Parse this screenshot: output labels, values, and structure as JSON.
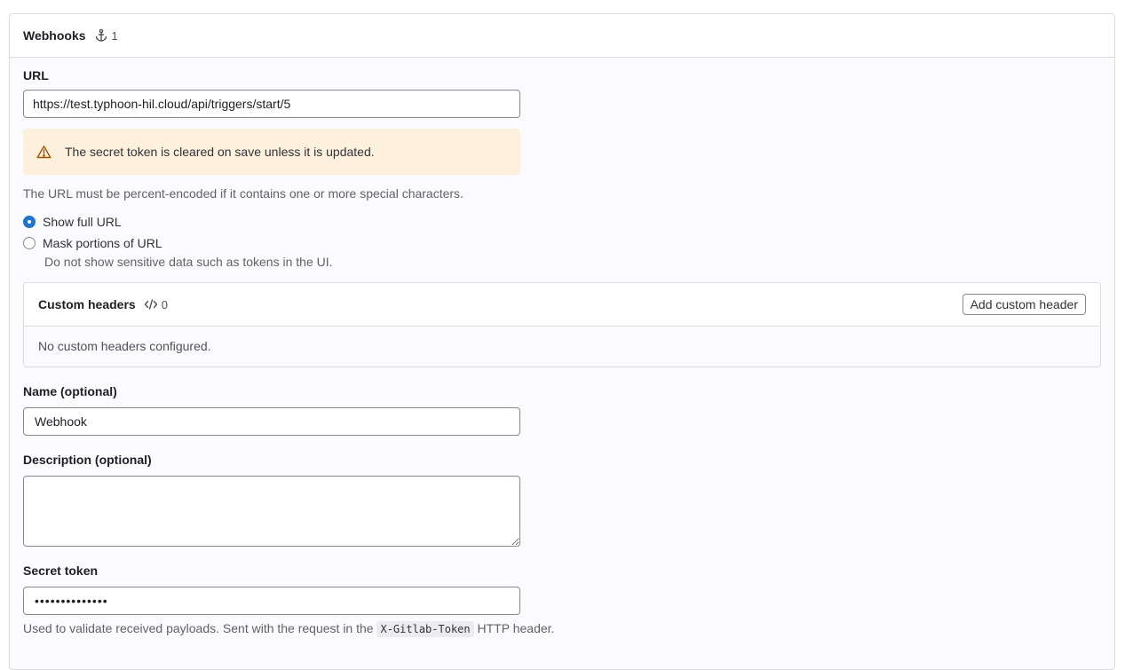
{
  "header": {
    "title": "Webhooks",
    "count": "1",
    "count_icon": "anchor-icon"
  },
  "url": {
    "label": "URL",
    "value": "https://test.typhoon-hil.cloud/api/triggers/start/5",
    "alert": "The secret token is cleared on save unless it is updated.",
    "help": "The URL must be percent-encoded if it contains one or more special characters."
  },
  "url_display": {
    "options": [
      {
        "label": "Show full URL",
        "checked": true
      },
      {
        "label": "Mask portions of URL",
        "checked": false,
        "help": "Do not show sensitive data such as tokens in the UI."
      }
    ]
  },
  "custom_headers": {
    "title": "Custom headers",
    "count": "0",
    "add_button": "Add custom header",
    "empty": "No custom headers configured."
  },
  "name": {
    "label": "Name (optional)",
    "value": "Webhook"
  },
  "description": {
    "label": "Description (optional)",
    "value": ""
  },
  "secret": {
    "label": "Secret token",
    "value": "••••••••••••••",
    "help_prefix": "Used to validate received payloads. Sent with the request in the",
    "help_code": "X-Gitlab-Token",
    "help_suffix": "HTTP header."
  },
  "colors": {
    "accent": "#1f75cb",
    "alert_bg": "#fdf1dd",
    "warning": "#9e5400"
  }
}
